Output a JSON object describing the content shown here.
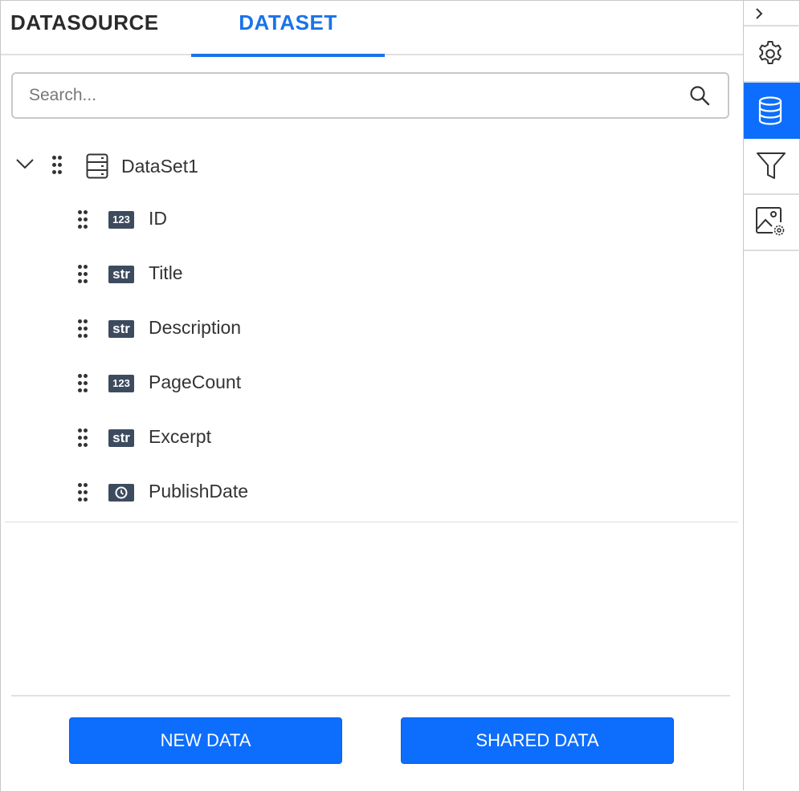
{
  "tabs": {
    "datasource": "DATASOURCE",
    "dataset": "DATASET",
    "active": "dataset"
  },
  "search": {
    "placeholder": "Search..."
  },
  "tree": {
    "dataset": {
      "label": "DataSet1",
      "expanded": true,
      "icon": "dataset-table-icon"
    },
    "fields": [
      {
        "label": "ID",
        "type": "123",
        "icon": "number-type-icon"
      },
      {
        "label": "Title",
        "type": "str",
        "icon": "string-type-icon"
      },
      {
        "label": "Description",
        "type": "str",
        "icon": "string-type-icon"
      },
      {
        "label": "PageCount",
        "type": "123",
        "icon": "number-type-icon"
      },
      {
        "label": "Excerpt",
        "type": "str",
        "icon": "string-type-icon"
      },
      {
        "label": "PublishDate",
        "type": "date",
        "icon": "clock-type-icon"
      }
    ]
  },
  "buttons": {
    "new_data": "NEW DATA",
    "shared_data": "SHARED DATA"
  },
  "rail": {
    "items": [
      "chevron-right-icon",
      "gear-icon",
      "database-icon",
      "filter-icon",
      "image-settings-icon"
    ],
    "active": "database-icon"
  },
  "colors": {
    "accent": "#1a73e8",
    "button": "#0d6efd",
    "badge": "#3d4b5f",
    "text": "#333333"
  }
}
